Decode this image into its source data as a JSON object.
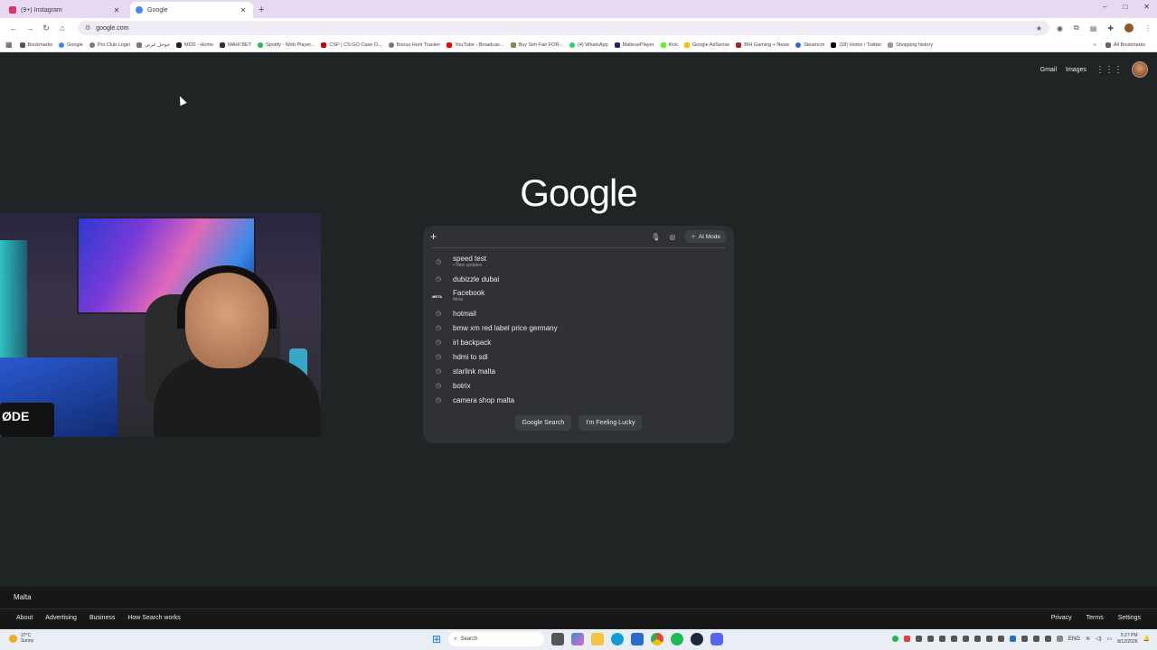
{
  "tabs": [
    {
      "title": "(9+) Instagram",
      "icon": "instagram-icon",
      "color": "#e1306c",
      "close": "✕"
    },
    {
      "title": "Google",
      "icon": "google-icon",
      "color": "#4285f4",
      "close": "✕"
    }
  ],
  "new_tab": "+",
  "window_controls": {
    "minimize": "–",
    "maximize": "□",
    "close": "✕"
  },
  "nav": {
    "back": "←",
    "forward": "→",
    "reload": "↻",
    "home": "⌂"
  },
  "url": "google.com",
  "bookmarks": {
    "items": [
      "Bookmarks",
      "Google",
      "Pro Club Login",
      "جوجل عربي",
      "MDD - Home",
      "MAHI BET",
      "Spotify - Web Player...",
      "CSP | CS:GO Case O...",
      "Bonus Hunt Tracker",
      "YouTube - Broadcas...",
      "Buy Sim-Fair FOR...",
      "(4) WhatsApp",
      "MaltesePlayer",
      "Kick",
      "Google AdSense",
      "BIH Gaming + News",
      "Steamcm",
      "(18) Home / Twitter",
      "Shopping history"
    ],
    "all_label": "All Bookmarks"
  },
  "header": {
    "gmail": "Gmail",
    "images": "Images",
    "apps_icon": "apps-grid-icon",
    "avatar_icon": "avatar"
  },
  "logo": "Google",
  "search": {
    "placeholder": "",
    "plus": "+",
    "mic_icon": "microphone-icon",
    "lens_icon": "lens-icon",
    "ai_mode": "AI Mode",
    "suggestions": [
      {
        "text": "speed test",
        "sub": "• New updates",
        "icon": "history-icon"
      },
      {
        "text": "dubizzle dubai",
        "sub": "",
        "icon": "history-icon"
      },
      {
        "text": "Facebook",
        "sub": "Meta",
        "icon": "facebook-logo"
      },
      {
        "text": "hotmail",
        "sub": "",
        "icon": "history-icon"
      },
      {
        "text": "bmw xm red label price germany",
        "sub": "",
        "icon": "history-icon"
      },
      {
        "text": "irl backpack",
        "sub": "",
        "icon": "history-icon"
      },
      {
        "text": "hdmi to sdi",
        "sub": "",
        "icon": "history-icon"
      },
      {
        "text": "starlink malta",
        "sub": "",
        "icon": "history-icon"
      },
      {
        "text": "botrix",
        "sub": "",
        "icon": "history-icon"
      },
      {
        "text": "camera shop malta",
        "sub": "",
        "icon": "history-icon"
      }
    ],
    "google_search": "Google Search",
    "feeling_lucky": "I'm Feeling Lucky"
  },
  "webcam": {
    "mic_brand": "ØDE"
  },
  "footer": {
    "country": "Malta",
    "left": [
      "About",
      "Advertising",
      "Business",
      "How Search works"
    ],
    "right": [
      "Privacy",
      "Terms",
      "Settings"
    ]
  },
  "taskbar": {
    "weather_temp": "37°C",
    "weather_desc": "Sunny",
    "search_placeholder": "Search",
    "lang": "ENG",
    "time": "5:27 PM",
    "date": "8/12/2026"
  }
}
